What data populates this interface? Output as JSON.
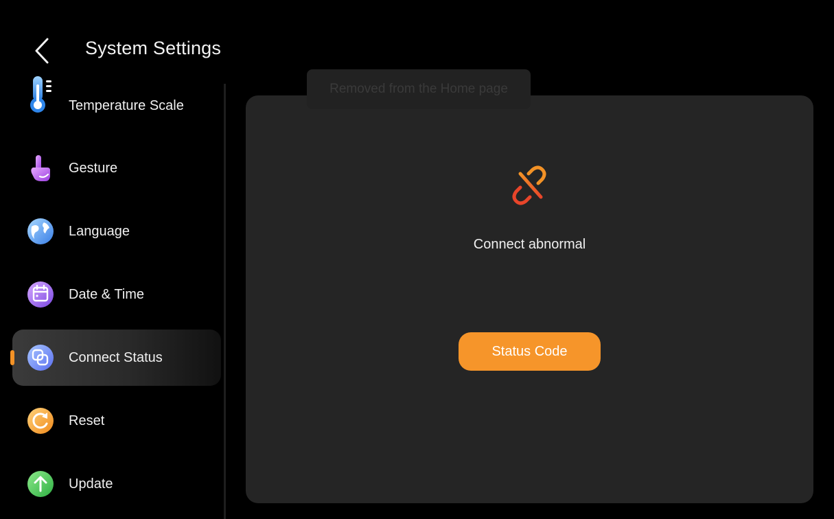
{
  "header": {
    "back_icon": "chevron-left-icon",
    "title": "System Settings"
  },
  "sidebar": {
    "items": [
      {
        "label": "Temperature Scale",
        "icon": "thermometer-icon",
        "active": false
      },
      {
        "label": "Gesture",
        "icon": "hand-pointer-icon",
        "active": false
      },
      {
        "label": "Language",
        "icon": "globe-icon",
        "active": false
      },
      {
        "label": "Date & Time",
        "icon": "calendar-icon",
        "active": false
      },
      {
        "label": "Connect Status",
        "icon": "overlap-squares-icon",
        "active": true
      },
      {
        "label": "Reset",
        "icon": "refresh-icon",
        "active": false
      },
      {
        "label": "Update",
        "icon": "arrow-up-icon",
        "active": false
      }
    ]
  },
  "toast": {
    "text": "Removed from the Home page"
  },
  "main": {
    "status_icon": "broken-link-icon",
    "status_text": "Connect abnormal",
    "button_label": "Status Code"
  },
  "colors": {
    "accent": "#f6952a",
    "panel": "#252525",
    "background": "#000000"
  }
}
